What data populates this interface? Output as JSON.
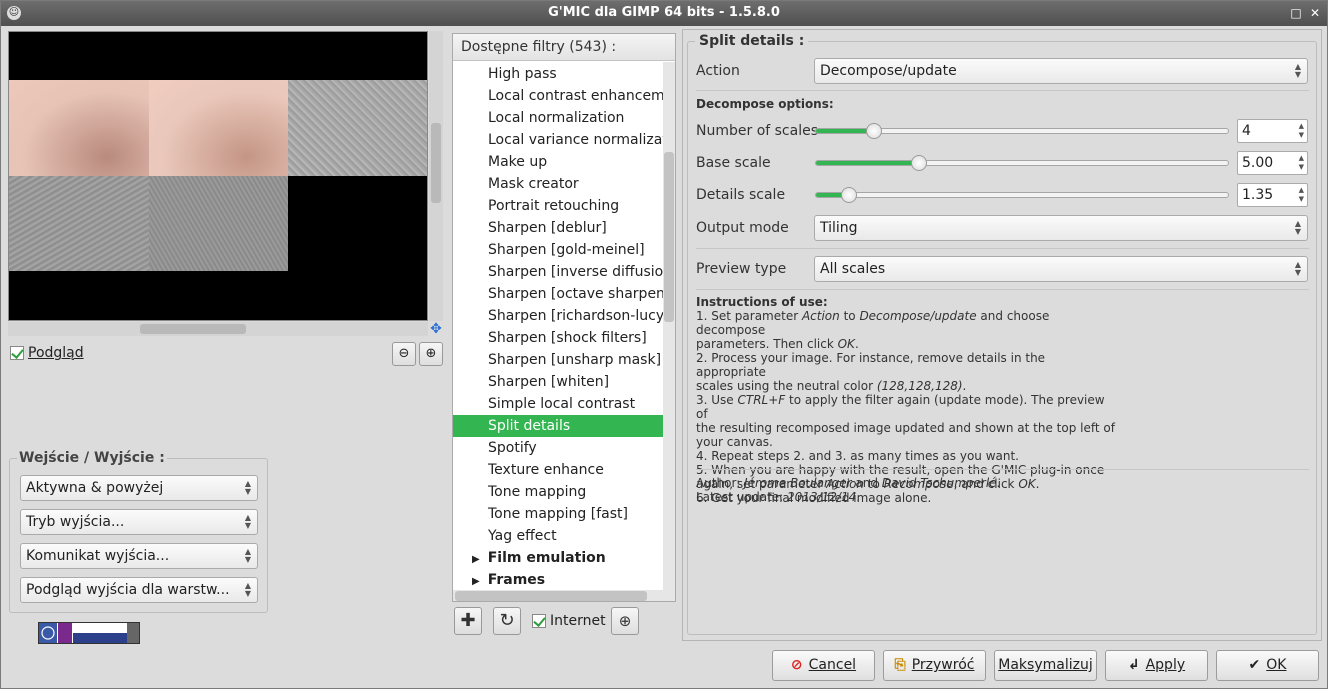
{
  "window": {
    "title": "G'MIC dla GIMP 64 bits - 1.5.8.0"
  },
  "preview": {
    "checkbox_label": "Podgląd"
  },
  "io": {
    "title": "Wejście / Wyjście :",
    "combos": [
      "Aktywna & powyżej",
      "Tryb wyjścia...",
      "Komunikat wyjścia...",
      "Podgląd wyjścia dla warstw..."
    ]
  },
  "filters": {
    "header": "Dostępne filtry (543) :",
    "items": [
      {
        "label": "High pass"
      },
      {
        "label": "Local contrast enhancement"
      },
      {
        "label": "Local normalization"
      },
      {
        "label": "Local variance normalization"
      },
      {
        "label": "Make up"
      },
      {
        "label": "Mask creator"
      },
      {
        "label": "Portrait retouching"
      },
      {
        "label": "Sharpen [deblur]"
      },
      {
        "label": "Sharpen [gold-meinel]"
      },
      {
        "label": "Sharpen [inverse diffusion]"
      },
      {
        "label": "Sharpen [octave sharpening]"
      },
      {
        "label": "Sharpen [richardson-lucy]"
      },
      {
        "label": "Sharpen [shock filters]"
      },
      {
        "label": "Sharpen [unsharp mask]"
      },
      {
        "label": "Sharpen [whiten]"
      },
      {
        "label": "Simple local contrast"
      },
      {
        "label": "Split details"
      },
      {
        "label": "Spotify"
      },
      {
        "label": "Texture enhance"
      },
      {
        "label": "Tone mapping"
      },
      {
        "label": "Tone mapping [fast]"
      },
      {
        "label": "Yag effect"
      }
    ],
    "categories": [
      "Film emulation",
      "Frames"
    ],
    "selected_index": 16,
    "internet_label": "Internet"
  },
  "params": {
    "title": "Split details :",
    "action_label": "Action",
    "action_value": "Decompose/update",
    "decompose_section": "Decompose options:",
    "num_scales_label": "Number of scales",
    "num_scales_value": "4",
    "num_scales_frac": 0.14,
    "base_scale_label": "Base scale",
    "base_scale_value": "5.00",
    "base_scale_frac": 0.25,
    "details_scale_label": "Details scale",
    "details_scale_value": "1.35",
    "details_scale_frac": 0.08,
    "output_mode_label": "Output mode",
    "output_mode_value": "Tiling",
    "preview_type_label": "Preview type",
    "preview_type_value": "All scales"
  },
  "instructions": {
    "heading": "Instructions of use:",
    "l1a": " 1. Set parameter ",
    "l1b": "Action",
    "l1c": " to ",
    "l1d": "Decompose/update",
    "l1e": " and choose decompose",
    "l2a": "parameters. Then click ",
    "l2b": "OK",
    "l2c": ".",
    "l3": " 2. Process your image. For instance, remove details in the appropriate",
    "l4a": "scales using the neutral color ",
    "l4b": "(128,128,128)",
    "l4c": ".",
    "l5a": " 3. Use ",
    "l5b": "CTRL+F",
    "l5c": " to apply the filter again (update mode). The preview of",
    "l6": "the resulting recomposed image updated and shown at the top left of",
    "l7": "your canvas.",
    "l8": " 4. Repeat steps 2. and 3. as many times as you want.",
    "l9": " 5. When you are happy with the result, open the G'MIC plug-in once",
    "l10a": "again, set parameter ",
    "l10b": "Action",
    "l10c": " to ",
    "l10d": "Recompose",
    "l10e": ", and click ",
    "l10f": "OK",
    "l10g": ".",
    "l11": " 6. Get your final modified image alone."
  },
  "author": {
    "a1": "Author: ",
    "a2": "Jérome Boulanger",
    "a3": " and ",
    "a4": "David Tschumperlé",
    "a5": ".",
    "u1": "Latest update: ",
    "u2": "2013/12/14",
    "u3": "."
  },
  "buttons": {
    "cancel": "Cancel",
    "reset": "Przywróć",
    "maximize": "Maksymalizuj",
    "apply": "Apply",
    "ok": "OK"
  },
  "colors": {
    "selection": "#33b551",
    "slider_fill": "#33b551"
  }
}
